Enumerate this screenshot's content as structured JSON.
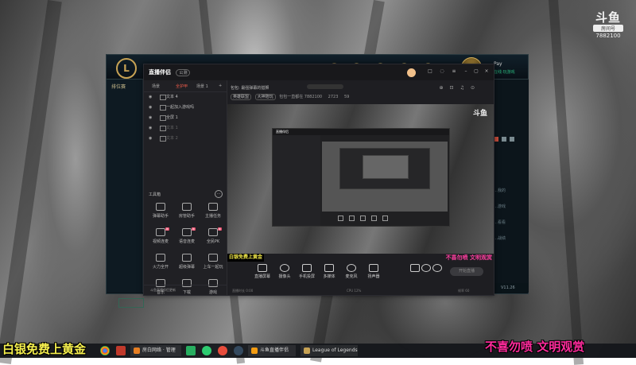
{
  "watermark": {
    "logo": "斗鱼",
    "sub": "房间号",
    "room": "7882100"
  },
  "lol": {
    "logo": "L",
    "left_label": "排位赛",
    "right_texts": [
      "…我的",
      "…游戏",
      "…看看",
      "…战绩",
      "…Mo"
    ],
    "bottom": "V11.26",
    "user": "Pay",
    "user_sub": "在线·玩游戏"
  },
  "companion": {
    "app_name": "直播伴侣",
    "version": "公测",
    "tabs": [
      "场景",
      "全护甲",
      "场景 1"
    ],
    "sources": [
      {
        "label": "文本 4",
        "dim": false
      },
      {
        "label": "一起加入游戏吗",
        "dim": false
      },
      {
        "label": "全屏 1",
        "dim": false
      },
      {
        "label": "文本 1",
        "dim": true
      },
      {
        "label": "文本 2",
        "dim": true
      }
    ],
    "tools_title": "工具箱",
    "tools": [
      {
        "label": "弹幕助手",
        "badge": ""
      },
      {
        "label": "房管助手",
        "badge": ""
      },
      {
        "label": "主播任务",
        "badge": ""
      },
      {
        "label": "视频连麦",
        "badge": "新"
      },
      {
        "label": "语音连麦",
        "badge": "新"
      },
      {
        "label": "全民PK",
        "badge": "新"
      },
      {
        "label": "火力全开",
        "badge": ""
      },
      {
        "label": "超级弹幕",
        "badge": ""
      },
      {
        "label": "上车一起玩",
        "badge": ""
      },
      {
        "label": "音乐",
        "badge": ""
      },
      {
        "label": "下载",
        "badge": ""
      },
      {
        "label": "游戏",
        "badge": ""
      }
    ],
    "footer": "斗鱼直播伴侣更新",
    "info_line1": "包包: 最强弹幕的猎狮",
    "info_pills": [
      "英雄联盟",
      "大神陪玩"
    ],
    "info_room": "包包一直都在 7882100",
    "info_hot": "2723",
    "info_fans": "59",
    "preview_overlay_left": "白银免费上黄金",
    "preview_overlay_right": "不喜勿喷 文明观赏",
    "preview_watermark": "斗鱼",
    "nested_title": "直播伴侣",
    "controls": [
      {
        "label": "直播屏幕"
      },
      {
        "label": "摄像头"
      },
      {
        "label": "手机投屏"
      },
      {
        "label": "多媒体"
      },
      {
        "label": "麦克风"
      },
      {
        "label": "扬声器"
      }
    ],
    "start_label": "开始直播",
    "status_left": "直播时长 0:00",
    "status_mid": "CPU 12%",
    "status_right": "帧率 60"
  },
  "captions": {
    "left": "白银免费上黄金",
    "right": "不喜勿喷 文明观赏"
  },
  "taskbar": {
    "windows": [
      {
        "label": "斗鱼直播伴侣"
      },
      {
        "label": "League of Legends"
      }
    ],
    "first_window": "房白网络 · 管理"
  },
  "colors": {
    "caption_left": "#f6f04e",
    "caption_right": "#ff2b9c",
    "lol_gold": "#c7a254"
  }
}
